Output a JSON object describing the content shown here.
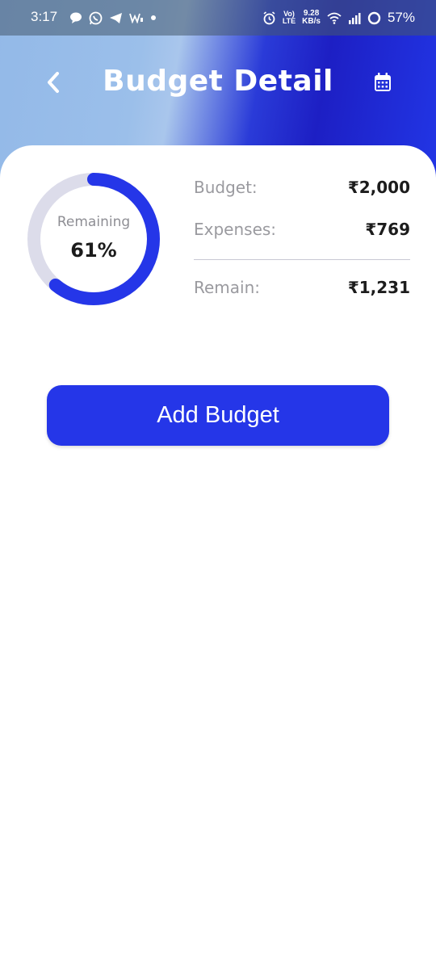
{
  "status_bar": {
    "time": "3:17",
    "volte_top": "Vo)",
    "volte_bottom": "LTE",
    "speed_value": "9.28",
    "speed_unit": "KB/s",
    "battery": "57%",
    "icons": [
      "chat-bubble-icon",
      "whatsapp-icon",
      "telegram-icon",
      "w-app-icon",
      "dot-icon",
      "alarm-icon",
      "volte-icon",
      "wifi-icon",
      "signal-icon",
      "battery-ring-icon"
    ]
  },
  "header": {
    "title": "Budget Detail",
    "back_icon": "chevron-left-icon",
    "calendar_icon": "calendar-icon"
  },
  "summary": {
    "ring_label": "Remaining",
    "remaining_percent": "61%",
    "remaining_fraction": 0.61,
    "ring_track_color": "#dcdcea",
    "ring_fill_color": "#2536e8",
    "rows": [
      {
        "label": "Budget:",
        "value": "₹2,000"
      },
      {
        "label": "Expenses:",
        "value": "₹769"
      },
      {
        "label": "Remain:",
        "value": "₹1,231"
      }
    ]
  },
  "actions": {
    "add_budget_label": "Add Budget",
    "accent_color": "#2536e8"
  }
}
